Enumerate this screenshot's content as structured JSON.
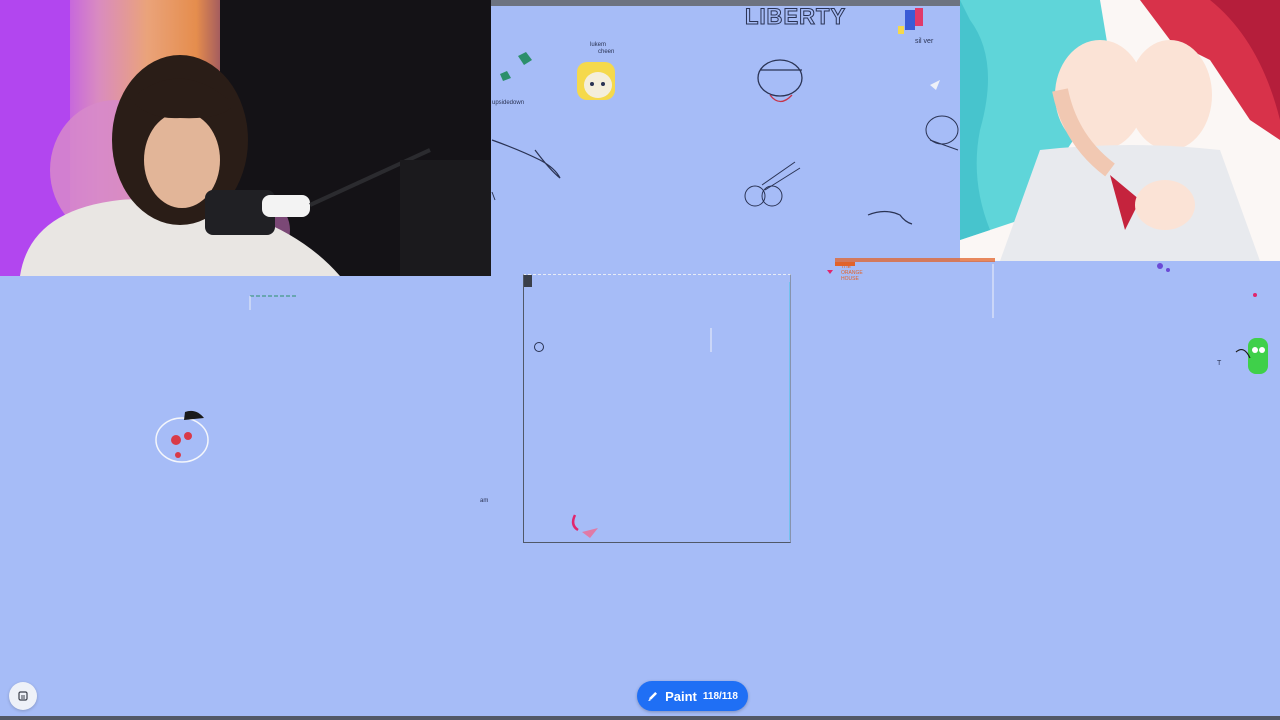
{
  "canvas": {
    "background": "#a6bcf7",
    "texts": {
      "liberty": "LIBERTY",
      "silver": "sil ver",
      "lukemi": "lukem",
      "lukemi2": "cheen",
      "upsidedown": "upsidedown",
      "am": "am",
      "t_mark": "T",
      "orange_note_1": "THE",
      "orange_note_2": "ORANGE",
      "orange_note_3": "HOUSE"
    }
  },
  "toolbar": {
    "paint_label": "Paint",
    "paint_count": "118/118",
    "paint_icon": "pencil-icon",
    "menu_icon": "menu-icon"
  },
  "colors": {
    "accent": "#1f6ff5",
    "canvas": "#a6bcf7"
  }
}
